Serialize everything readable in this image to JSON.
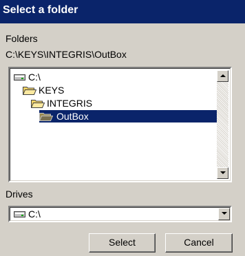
{
  "window": {
    "title": "Select a folder"
  },
  "folders": {
    "label": "Folders",
    "current_path": "C:\\KEYS\\INTEGRIS\\OutBox",
    "tree": [
      {
        "label": "C:\\",
        "icon": "drive-icon",
        "level": 0,
        "selected": false
      },
      {
        "label": "KEYS",
        "icon": "folder-open-icon",
        "level": 1,
        "selected": false
      },
      {
        "label": "INTEGRIS",
        "icon": "folder-open-icon",
        "level": 2,
        "selected": false
      },
      {
        "label": "OutBox",
        "icon": "folder-open-icon",
        "level": 3,
        "selected": true
      }
    ]
  },
  "drives": {
    "label": "Drives",
    "selected": "C:\\"
  },
  "buttons": {
    "select": "Select",
    "cancel": "Cancel"
  },
  "colors": {
    "titlebar": "#0a246a",
    "selection": "#0a246a",
    "face": "#d4d0c8",
    "folder": "#f2d264"
  }
}
